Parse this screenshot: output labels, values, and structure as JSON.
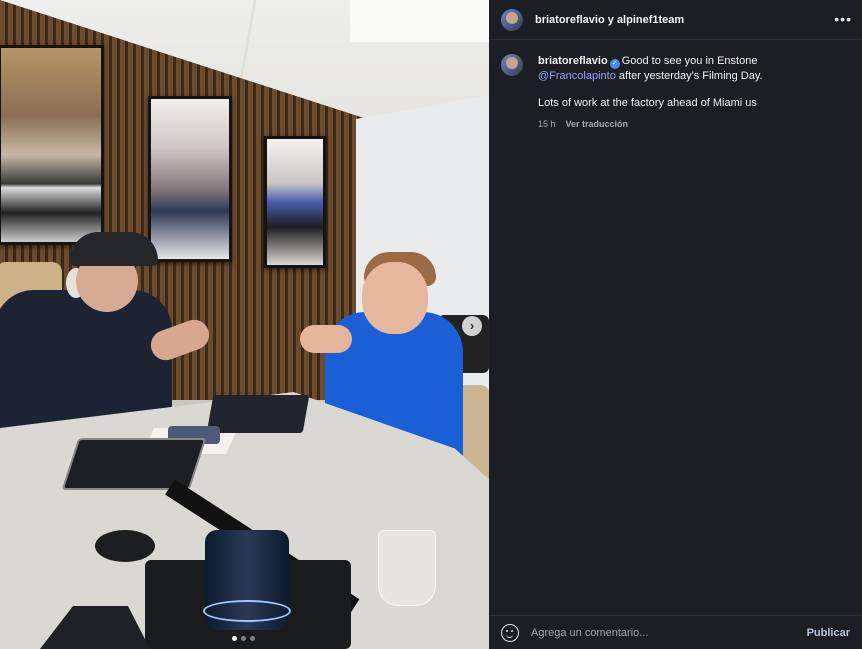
{
  "header": {
    "user1": "briatoreflavio",
    "conjunction": "y",
    "user2": "alpinef1team",
    "more_icon": "more-horizontal-icon"
  },
  "caption": {
    "username": "briatoreflavio",
    "verified_icon": "verified-badge-icon",
    "text_before_mention": "Good to see you in Enstone ",
    "mention": "@Francolapinto",
    "text_after_mention": "after yesterday's Filming Day.",
    "paragraph2": "Lots of work at the factory ahead of Miami us",
    "time": "15 h",
    "translate": "Ver traducción"
  },
  "media": {
    "next_icon": "chevron-right-icon",
    "carousel_slides": 3,
    "active_slide": 1
  },
  "footer": {
    "emoji_icon": "smiley-icon",
    "comment_placeholder": "Agrega un comentario...",
    "publish_label": "Publicar"
  },
  "colors": {
    "panel_bg": "#1c1e24",
    "mention": "#8aa7ff",
    "verified": "#3d8df0"
  }
}
